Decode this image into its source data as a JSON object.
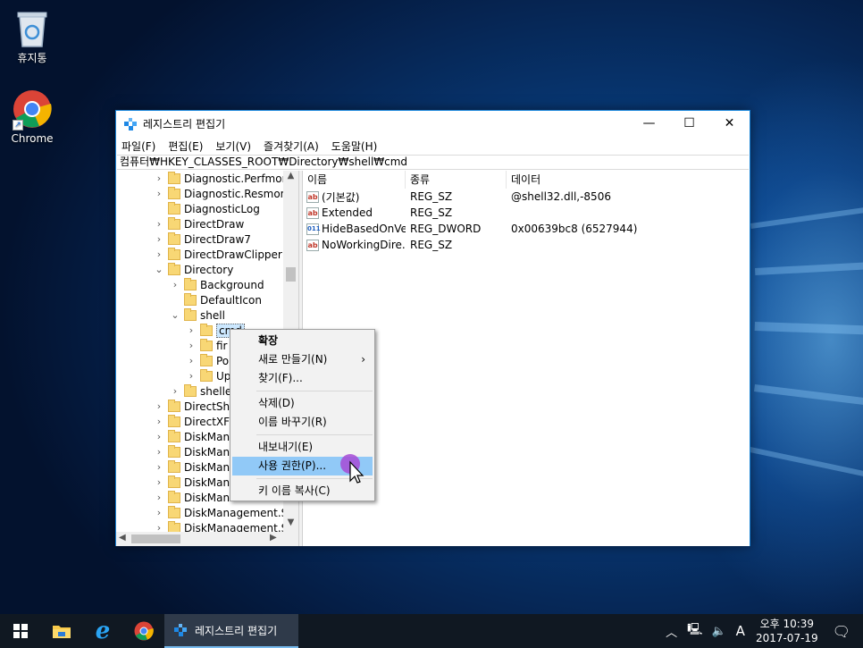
{
  "desktop": {
    "icons": [
      {
        "label": "휴지통",
        "icon": "recycle-bin-icon"
      },
      {
        "label": "Chrome",
        "icon": "chrome-icon"
      }
    ]
  },
  "window": {
    "title": "레지스트리 편집기",
    "controls": {
      "minimize": "—",
      "maximize": "☐",
      "close": "✕"
    },
    "menu": [
      "파일(F)",
      "편집(E)",
      "보기(V)",
      "즐겨찾기(A)",
      "도움말(H)"
    ],
    "address": "컴퓨터₩HKEY_CLASSES_ROOT₩Directory₩shell₩cmd",
    "tree": [
      {
        "label": "Diagnostic.Perfmon.D",
        "indent": 0,
        "chev": "›"
      },
      {
        "label": "Diagnostic.Resmon.C",
        "indent": 0,
        "chev": "›"
      },
      {
        "label": "DiagnosticLog",
        "indent": 0,
        "chev": ""
      },
      {
        "label": "DirectDraw",
        "indent": 0,
        "chev": "›"
      },
      {
        "label": "DirectDraw7",
        "indent": 0,
        "chev": "›"
      },
      {
        "label": "DirectDrawClipper",
        "indent": 0,
        "chev": "›"
      },
      {
        "label": "Directory",
        "indent": 0,
        "chev": "⌄"
      },
      {
        "label": "Background",
        "indent": 1,
        "chev": "›"
      },
      {
        "label": "DefaultIcon",
        "indent": 1,
        "chev": ""
      },
      {
        "label": "shell",
        "indent": 1,
        "chev": "⌄"
      },
      {
        "label": "cmd",
        "indent": 2,
        "chev": "›",
        "selected": true
      },
      {
        "label": "fir",
        "indent": 2,
        "chev": "›"
      },
      {
        "label": "Po",
        "indent": 2,
        "chev": "›"
      },
      {
        "label": "Up",
        "indent": 2,
        "chev": "›"
      },
      {
        "label": "shelle",
        "indent": 1,
        "chev": "›"
      },
      {
        "label": "DirectSho",
        "indent": 0,
        "chev": "›"
      },
      {
        "label": "DirectXFil",
        "indent": 0,
        "chev": "›"
      },
      {
        "label": "DiskMana",
        "indent": 0,
        "chev": "›"
      },
      {
        "label": "DiskMana",
        "indent": 0,
        "chev": "›"
      },
      {
        "label": "DiskMana",
        "indent": 0,
        "chev": "›"
      },
      {
        "label": "DiskMana",
        "indent": 0,
        "chev": "›"
      },
      {
        "label": "DiskMana",
        "indent": 0,
        "chev": "›"
      },
      {
        "label": "DiskManagement.Sna",
        "indent": 0,
        "chev": "›"
      },
      {
        "label": "DiskManagement.Sna",
        "indent": 0,
        "chev": "›"
      }
    ],
    "list": {
      "columns": [
        "이름",
        "종류",
        "데이터"
      ],
      "rows": [
        {
          "name": "(기본값)",
          "type": "REG_SZ",
          "data": "@shell32.dll,-8506",
          "icon": "ab"
        },
        {
          "name": "Extended",
          "type": "REG_SZ",
          "data": "",
          "icon": "ab"
        },
        {
          "name": "HideBasedOnVe...",
          "type": "REG_DWORD",
          "data": "0x00639bc8 (6527944)",
          "icon": "bin"
        },
        {
          "name": "NoWorkingDire...",
          "type": "REG_SZ",
          "data": "",
          "icon": "ab"
        }
      ]
    }
  },
  "context_menu": {
    "items": [
      {
        "label": "확장",
        "bold": true
      },
      {
        "label": "새로 만들기(N)",
        "submenu": true
      },
      {
        "label": "찾기(F)..."
      },
      {
        "sep": true
      },
      {
        "label": "삭제(D)"
      },
      {
        "label": "이름 바꾸기(R)"
      },
      {
        "sep": true
      },
      {
        "label": "내보내기(E)"
      },
      {
        "label": "사용 권한(P)...",
        "hover": true
      },
      {
        "sep": true
      },
      {
        "label": "키 이름 복사(C)"
      }
    ]
  },
  "taskbar": {
    "active_app": "레지스트리 편집기",
    "ime": "A",
    "time": "오후 10:39",
    "date": "2017-07-19"
  },
  "colors": {
    "accent": "#1883d7",
    "hover": "#91c9f7",
    "taskbar": "#101822"
  }
}
